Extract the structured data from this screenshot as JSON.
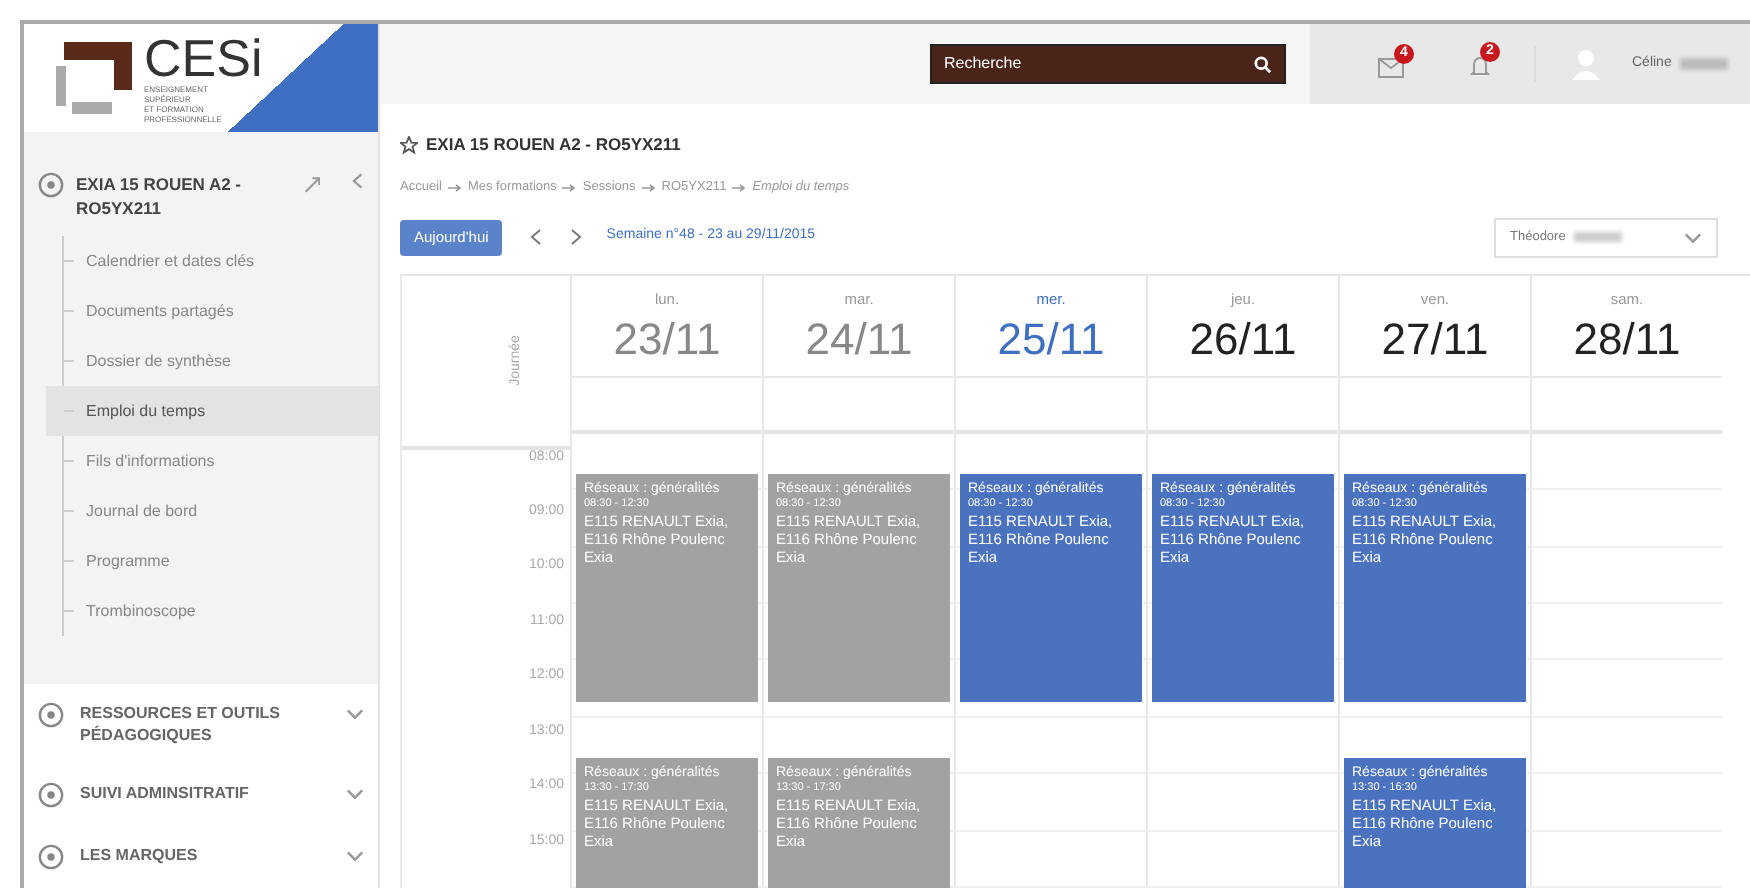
{
  "logo": {
    "name": "CESi",
    "tagline": [
      "ENSEIGNEMENT",
      "SUPÉRIEUR",
      "ET FORMATION",
      "PROFESSIONNELLE"
    ]
  },
  "sidebar": {
    "course": {
      "title": "EXIA 15 ROUEN A2 - RO5YX211"
    },
    "items": [
      {
        "label": "Calendrier et dates clés",
        "selected": false
      },
      {
        "label": "Documents partagés",
        "selected": false
      },
      {
        "label": "Dossier de synthèse",
        "selected": false
      },
      {
        "label": "Emploi du temps",
        "selected": true
      },
      {
        "label": "Fils d'informations",
        "selected": false
      },
      {
        "label": "Journal de bord",
        "selected": false
      },
      {
        "label": "Programme",
        "selected": false
      },
      {
        "label": "Trombinoscope",
        "selected": false
      }
    ],
    "sections": [
      {
        "title": "RESSOURCES ET OUTILS PÉDAGOGIQUES",
        "expanded": false
      },
      {
        "title": "SUIVI ADMINSITRATIF",
        "expanded": false
      },
      {
        "title": "LES MARQUES",
        "expanded": false
      }
    ]
  },
  "topbar": {
    "search": {
      "placeholder": "Recherche"
    },
    "messages_badge": "4",
    "notifications_badge": "2",
    "user": "Céline"
  },
  "page": {
    "title": "EXIA 15 ROUEN A2 - RO5YX211",
    "breadcrumb": [
      "Accueil",
      "Mes formations",
      "Sessions",
      "RO5YX211",
      "Emploi du temps"
    ],
    "today_button": "Aujourd'hui",
    "week": "Semaine n°48 - 23 au 29/11/2015",
    "person_select": "Théodore"
  },
  "calendar": {
    "allday_label": "Journée",
    "hours": [
      "08:00",
      "09:00",
      "10:00",
      "11:00",
      "12:00",
      "13:00",
      "14:00",
      "15:00"
    ],
    "days": [
      {
        "name": "lun.",
        "date": "23/11",
        "past": true,
        "today": false,
        "morning": {
          "title": "Réseaux : généralités",
          "time": "08:30 - 12:30",
          "place": "E115 RENAULT Exia, E116 Rhône Poulenc Exia"
        },
        "afternoon": {
          "title": "Réseaux : généralités",
          "time": "13:30 - 17:30",
          "place": "E115 RENAULT Exia, E116 Rhône Poulenc Exia"
        }
      },
      {
        "name": "mar.",
        "date": "24/11",
        "past": true,
        "today": false,
        "morning": {
          "title": "Réseaux : généralités",
          "time": "08:30 - 12:30",
          "place": "E115 RENAULT Exia, E116 Rhône Poulenc Exia"
        },
        "afternoon": {
          "title": "Réseaux : généralités",
          "time": "13:30 - 17:30",
          "place": "E115 RENAULT Exia, E116 Rhône Poulenc Exia"
        }
      },
      {
        "name": "mer.",
        "date": "25/11",
        "past": false,
        "today": true,
        "morning": {
          "title": "Réseaux : généralités",
          "time": "08:30 - 12:30",
          "place": "E115 RENAULT Exia, E116 Rhône Poulenc Exia"
        }
      },
      {
        "name": "jeu.",
        "date": "26/11",
        "past": false,
        "today": false,
        "morning": {
          "title": "Réseaux : généralités",
          "time": "08:30 - 12:30",
          "place": "E115 RENAULT Exia, E116 Rhône Poulenc Exia"
        }
      },
      {
        "name": "ven.",
        "date": "27/11",
        "past": false,
        "today": false,
        "morning": {
          "title": "Réseaux : généralités",
          "time": "08:30 - 12:30",
          "place": "E115 RENAULT Exia, E116 Rhône Poulenc Exia"
        },
        "afternoon": {
          "title": "Réseaux : généralités",
          "time": "13:30 - 16:30",
          "place": "E115 RENAULT Exia, E116 Rhône Poulenc Exia"
        }
      },
      {
        "name": "sam.",
        "date": "28/11",
        "past": false,
        "today": false
      }
    ]
  }
}
